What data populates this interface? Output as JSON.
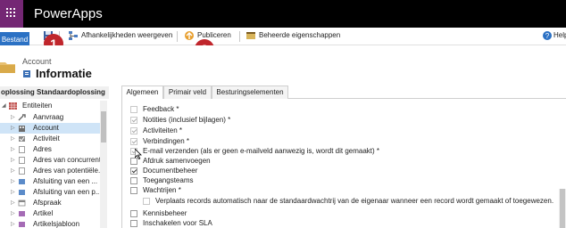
{
  "app": {
    "title": "PowerApps"
  },
  "colors": {
    "brand": "#742774",
    "accent": "#2b71c4",
    "badge": "#c0262c",
    "selected": "#cfe4f7"
  },
  "command_bar": {
    "file_label": "Bestand",
    "items": [
      {
        "label": "Afhankelijkheden weergeven",
        "icon": "dependencies-icon"
      },
      {
        "label": "Publiceren",
        "icon": "publish-icon"
      },
      {
        "label": "Beheerde eigenschappen",
        "icon": "managed-properties-icon"
      }
    ],
    "help_label": "Help"
  },
  "badges": [
    "1",
    "2"
  ],
  "header": {
    "breadcrumb": "Account",
    "title": "Informatie"
  },
  "solution": {
    "label": "oplossing Standaardoplossing"
  },
  "tree": {
    "root": "Entiteiten",
    "items": [
      {
        "label": "Aanvraag",
        "selected": false
      },
      {
        "label": "Account",
        "selected": true
      },
      {
        "label": "Activiteit",
        "selected": false
      },
      {
        "label": "Adres",
        "selected": false
      },
      {
        "label": "Adres van concurrent",
        "selected": false
      },
      {
        "label": "Adres van potentiële...",
        "selected": false
      },
      {
        "label": "Afsluiting van een ...",
        "selected": false
      },
      {
        "label": "Afsluiting van een p...",
        "selected": false
      },
      {
        "label": "Afspraak",
        "selected": false
      },
      {
        "label": "Artikel",
        "selected": false
      },
      {
        "label": "Artikelsjabloon",
        "selected": false
      }
    ]
  },
  "tabs": [
    {
      "label": "Algemeen",
      "active": true
    },
    {
      "label": "Primair veld",
      "active": false
    },
    {
      "label": "Besturingselementen",
      "active": false
    }
  ],
  "options": [
    {
      "label": "Feedback *",
      "checked": false,
      "disabled": true
    },
    {
      "label": "Notities (inclusief bijlagen) *",
      "checked": true,
      "disabled": true
    },
    {
      "label": "Activiteiten *",
      "checked": true,
      "disabled": true
    },
    {
      "label": "Verbindingen *",
      "checked": true,
      "disabled": true
    },
    {
      "label": "E-mail verzenden (als er geen e-mailveld aanwezig is, wordt dit gemaakt) *",
      "checked": true,
      "disabled": true
    },
    {
      "label": "Afdruk samenvoegen",
      "checked": false,
      "disabled": false
    },
    {
      "label": "Documentbeheer",
      "checked": true,
      "disabled": false
    },
    {
      "label": "Toegangsteams",
      "checked": false,
      "disabled": false
    },
    {
      "label": "Wachtrijen *",
      "checked": false,
      "disabled": false
    },
    {
      "label": "Verplaats records automatisch naar de standaardwachtrij van de eigenaar wanneer een record wordt gemaakt of toegewezen.",
      "checked": false,
      "disabled": true,
      "indent": true
    },
    {
      "label": "Kennisbeheer",
      "checked": false,
      "disabled": false
    },
    {
      "label": "Inschakelen voor SLA",
      "checked": false,
      "disabled": false
    }
  ]
}
